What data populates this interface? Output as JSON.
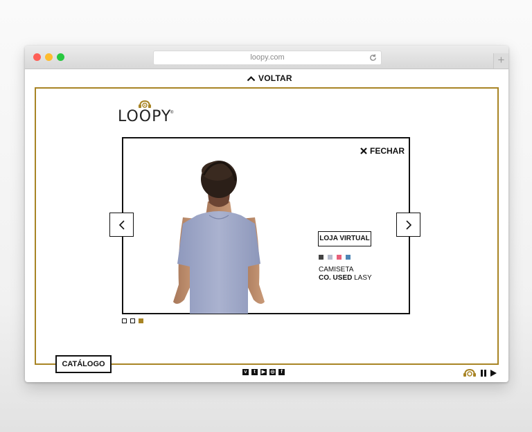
{
  "browser": {
    "url": "loopy.com",
    "new_tab": "+"
  },
  "nav": {
    "back_label": "VOLTAR"
  },
  "brand": {
    "logo_text": "LOOPY",
    "reg_mark": "®"
  },
  "viewer": {
    "close_label": "FECHAR"
  },
  "product": {
    "store_button": "LOJA VIRTUAL",
    "type": "CAMISETA",
    "model_bold": "CO. USED",
    "model_rest": " LASY",
    "swatches": [
      "#444444",
      "#b6bccd",
      "#e8607a",
      "#4e86b5"
    ]
  },
  "pager": {
    "count": 3,
    "active_index": 2
  },
  "footer": {
    "catalog_label": "CATÁLOGO",
    "social_icons": [
      "vimeo-icon",
      "twitter-icon",
      "youtube-icon",
      "instagram-icon",
      "facebook-icon"
    ],
    "social_glyphs": [
      "v",
      "t",
      "▶",
      "◎",
      "f"
    ]
  },
  "colors": {
    "accent": "#a88424",
    "ink": "#111111"
  }
}
